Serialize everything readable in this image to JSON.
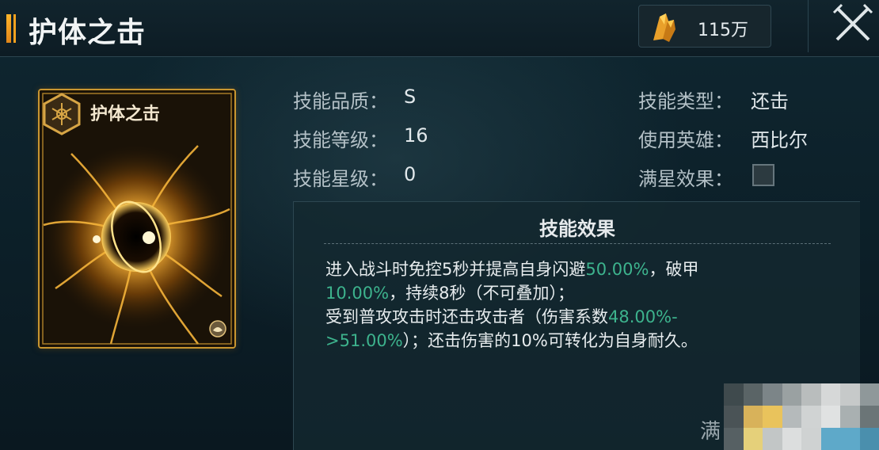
{
  "header": {
    "title": "护体之击",
    "currency": {
      "icon": "gold-crystal-icon",
      "value": "115万"
    },
    "close_icon": "crossed-swords-close-icon"
  },
  "card": {
    "name": "护体之击",
    "badge_icon": "hexagon-emblem-icon",
    "corner_icon": "hero-portrait-icon"
  },
  "stats": {
    "quality": {
      "label": "技能品质：",
      "value": "S"
    },
    "level": {
      "label": "技能等级：",
      "value": "16"
    },
    "star": {
      "label": "技能星级：",
      "value": "0"
    },
    "type": {
      "label": "技能类型：",
      "value": "还击"
    },
    "hero": {
      "label": "使用英雄：",
      "value": "西比尔"
    },
    "full_star": {
      "label": "满星效果：",
      "checked": false
    }
  },
  "effect": {
    "title": "技能效果",
    "line1_a": "进入战斗时免控5秒并提高自身闪避",
    "line1_b": "50.00%",
    "line1_c": "，破甲",
    "line2_a": "10.00%",
    "line2_b": "，持续8秒（不可叠加）；",
    "line3_a": "受到普攻攻击时还击攻击者（伤害系数",
    "line3_b": "48.00%-",
    "line4_a": ">51.00%",
    "line4_b": "）；还击伤害的10%可转化为自身耐久。"
  },
  "footer_partial_label": "满",
  "colors": {
    "accent_gold": "#f7a21f",
    "highlight_green": "#3db38d",
    "panel_bg": "#142830"
  }
}
